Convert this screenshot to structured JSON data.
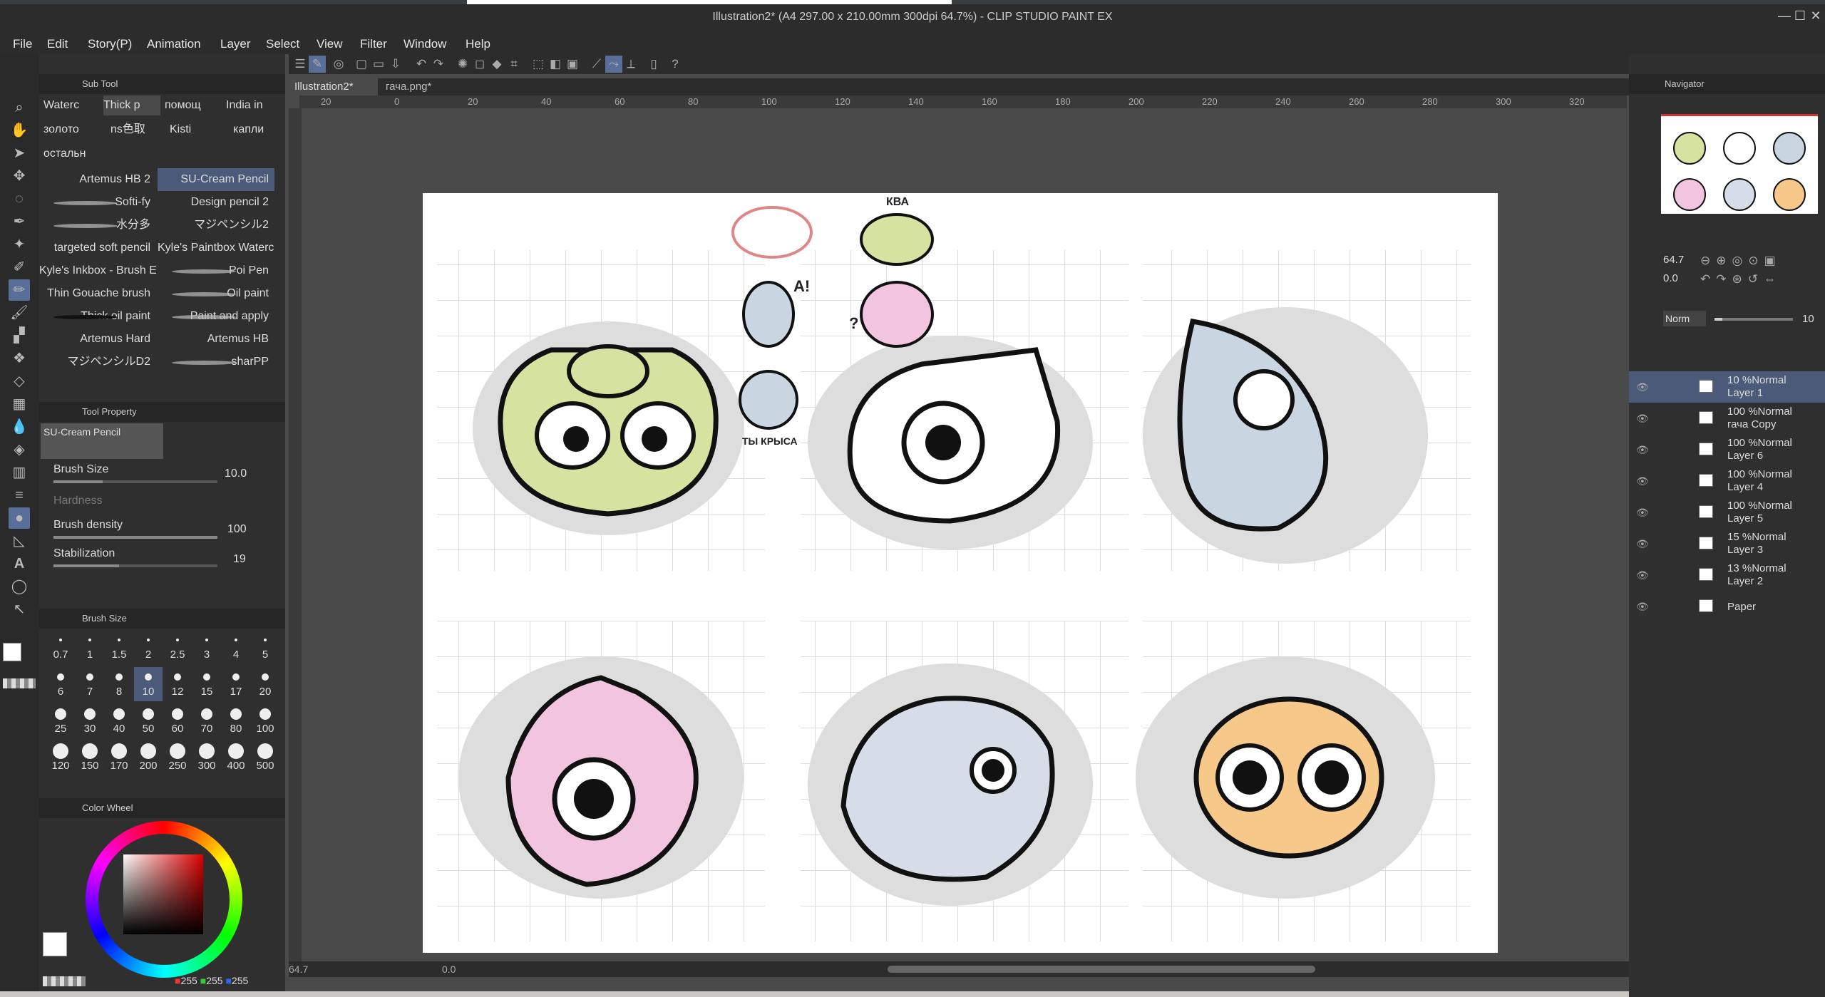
{
  "window": {
    "title": "Illustration2* (A4 297.00 x 210.00mm 300dpi 64.7%)  - CLIP STUDIO PAINT EX"
  },
  "menu": [
    "File",
    "Edit",
    "Story(P)",
    "Animation",
    "Layer",
    "Select",
    "View",
    "Filter",
    "Window",
    "Help"
  ],
  "subtool": {
    "header": "Sub Tool",
    "groups": [
      "Waterc",
      "Thick p",
      "помощ",
      "India in",
      "золото",
      "ns色取",
      "Kisti",
      "капли",
      "остальн"
    ],
    "brushes": [
      [
        "Artemus HB 2",
        "SU-Cream Pencil"
      ],
      [
        "Softi-fy",
        "Design pencil 2"
      ],
      [
        "水分多",
        "マジペンシル2"
      ],
      [
        "targeted soft pencil",
        "Kyle's Paintbox Waterco"
      ],
      [
        "Kyle's Inkbox - Brush E",
        "Poi Pen"
      ],
      [
        "Thin Gouache brush",
        "Oil paint"
      ],
      [
        "Thick oil paint",
        "Paint and apply"
      ],
      [
        "Artemus Hard",
        "Artemus HB"
      ],
      [
        "マジペンシルD2",
        "sharPP"
      ]
    ]
  },
  "toolprop": {
    "header": "Tool Property",
    "current_brush": "SU-Cream Pencil",
    "brush_size_label": "Brush Size",
    "brush_size": "10.0",
    "hardness_label": "Hardness",
    "density_label": "Brush density",
    "density": "100",
    "stab_label": "Stabilization",
    "stab": "19"
  },
  "brushsize": {
    "header": "Brush Size",
    "values": [
      "0.7",
      "1",
      "1.5",
      "2",
      "2.5",
      "3",
      "4",
      "5",
      "6",
      "7",
      "8",
      "10",
      "12",
      "15",
      "17",
      "20",
      "25",
      "30",
      "40",
      "50",
      "60",
      "70",
      "80",
      "100",
      "120",
      "150",
      "170",
      "200",
      "250",
      "300",
      "400",
      "500"
    ],
    "selected": "10"
  },
  "color": {
    "header": "Color Wheel",
    "r": "255",
    "g": "255",
    "b": "255"
  },
  "tabs": [
    "Illustration2*",
    "гача.png*"
  ],
  "ruler": [
    "20",
    "0",
    "20",
    "40",
    "60",
    "80",
    "100",
    "120",
    "140",
    "160",
    "180",
    "200",
    "220",
    "240",
    "260",
    "280",
    "300",
    "320"
  ],
  "canvas_text": {
    "kva": "КВА",
    "a": "А!",
    "q": "?",
    "rat": "ТЫ КРЫСА"
  },
  "navigator": {
    "header": "Navigator",
    "zoom": "64.7",
    "angle": "0.0"
  },
  "layers": {
    "blend_mode": "Norm",
    "opacity_value": "10",
    "items": [
      {
        "mode": "10 %Normal",
        "name": "Layer 1",
        "selected": true
      },
      {
        "mode": "100 %Normal",
        "name": "гача Copy"
      },
      {
        "mode": "100 %Normal",
        "name": "Layer 6"
      },
      {
        "mode": "100 %Normal",
        "name": "Layer 4"
      },
      {
        "mode": "100 %Normal",
        "name": "Layer 5"
      },
      {
        "mode": "15 %Normal",
        "name": "Layer 3"
      },
      {
        "mode": "13 %Normal",
        "name": "Layer 2"
      },
      {
        "mode": "",
        "name": "Paper"
      }
    ]
  },
  "status": {
    "zoom": "64.7",
    "angle": "0.0"
  },
  "colors": {
    "accent": "#5a6e9a",
    "selection": "#4a5a78",
    "panel": "#2f2f2f"
  }
}
